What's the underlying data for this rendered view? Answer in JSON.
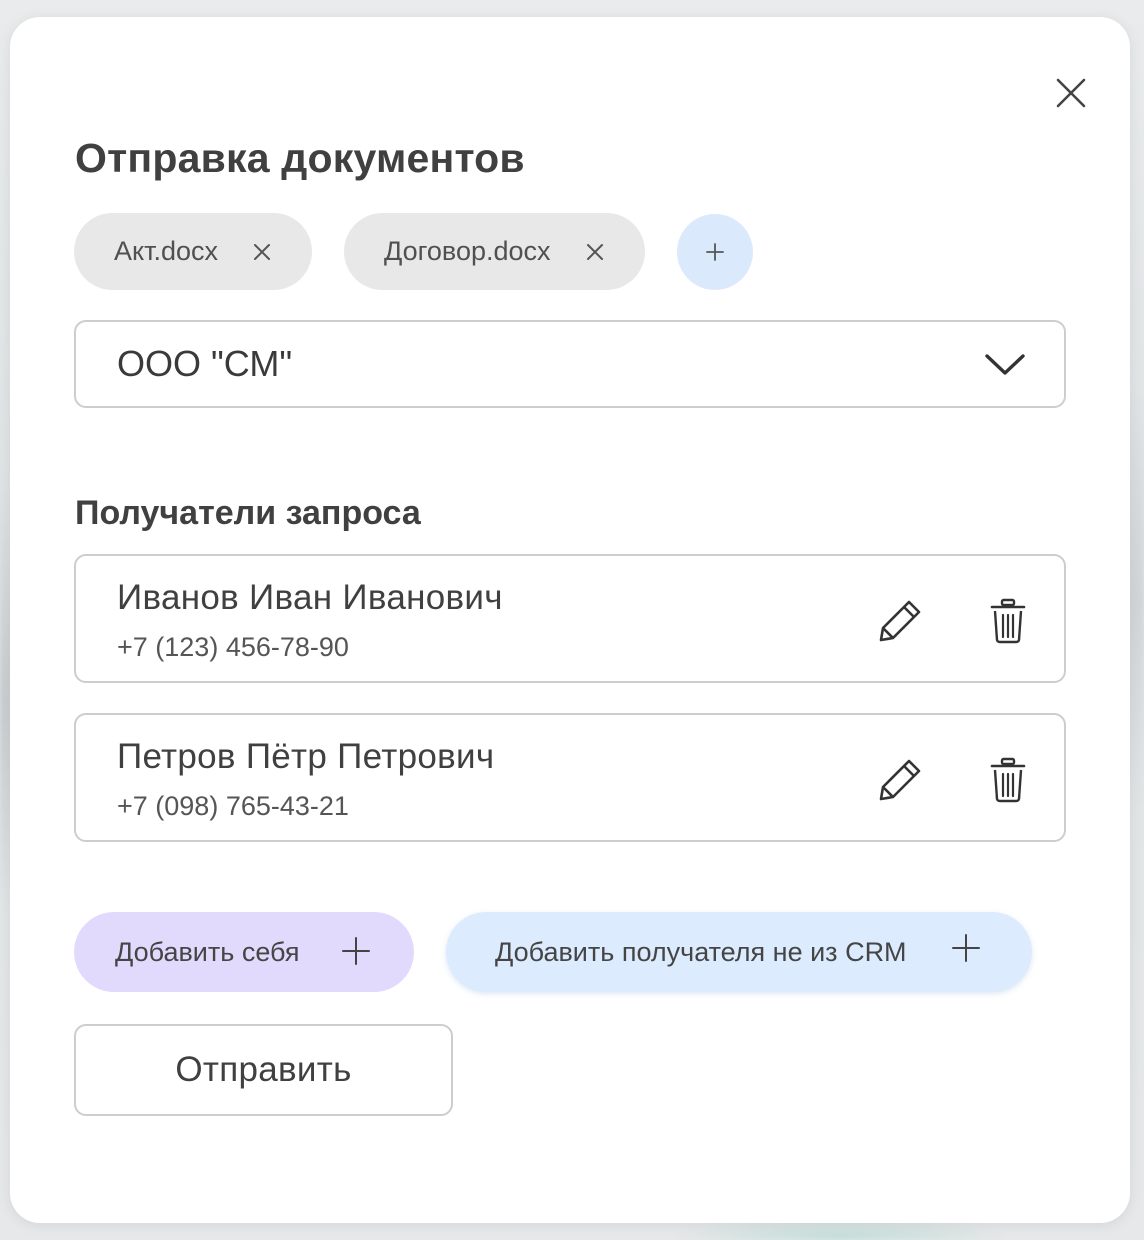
{
  "dialog": {
    "title": "Отправка документов",
    "close_icon": "close-icon"
  },
  "attachments": [
    {
      "label": "Акт.docx",
      "remove_icon": "close-icon"
    },
    {
      "label": "Договор.docx",
      "remove_icon": "close-icon"
    }
  ],
  "add_attachment_icon": "plus-icon",
  "organization_select": {
    "value": "ООО \"СМ\"",
    "icon": "chevron-down-icon"
  },
  "recipients_section": {
    "title": "Получатели запроса",
    "items": [
      {
        "name": "Иванов Иван Иванович",
        "phone": "+7 (123) 456-78-90",
        "edit_icon": "pencil-icon",
        "delete_icon": "trash-icon"
      },
      {
        "name": "Петров Пётр Петрович",
        "phone": "+7 (098) 765-43-21",
        "edit_icon": "pencil-icon",
        "delete_icon": "trash-icon"
      }
    ]
  },
  "actions": {
    "add_self_label": "Добавить себя",
    "add_external_label": "Добавить получателя не из CRM",
    "send_label": "Отправить"
  },
  "colors": {
    "chip_bg": "#e8e8e8",
    "add_file_bg": "#dbe9fc",
    "add_self_bg": "#e2dafc",
    "add_external_bg": "#dcebfd",
    "border": "#cdcdcd",
    "text": "#404040"
  }
}
